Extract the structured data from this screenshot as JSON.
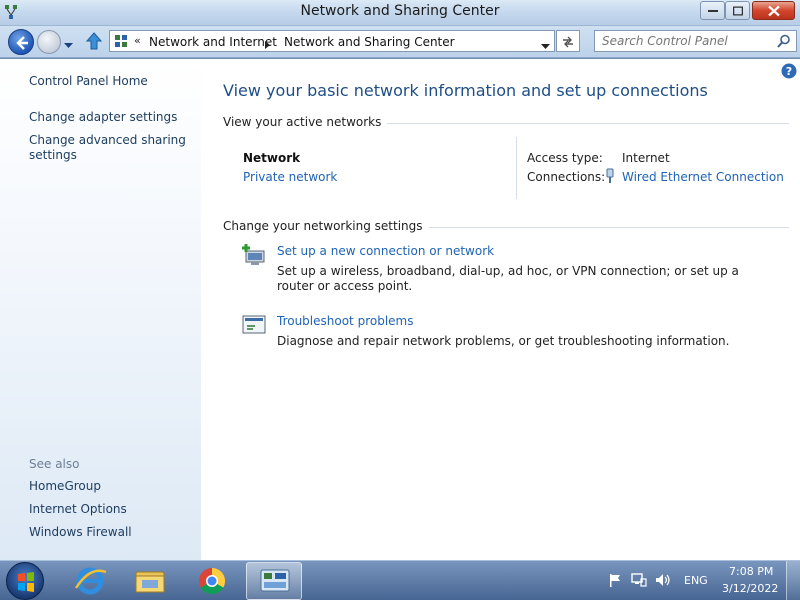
{
  "window": {
    "title": "Network and Sharing Center"
  },
  "navbar": {
    "breadcrumb": [
      "Network and Internet",
      "Network and Sharing Center"
    ],
    "overflow_chevron": "«",
    "search_placeholder": "Search Control Panel"
  },
  "left_pane": {
    "links": [
      "Control Panel Home",
      "Change adapter settings",
      "Change advanced sharing settings"
    ],
    "see_also_label": "See also",
    "see_also_links": [
      "HomeGroup",
      "Internet Options",
      "Windows Firewall"
    ]
  },
  "main": {
    "title": "View your basic network information and set up connections",
    "active_networks_heading": "View your active networks",
    "network": {
      "name": "Network",
      "type": "Private network",
      "access_type_label": "Access type:",
      "access_type_value": "Internet",
      "connections_label": "Connections:",
      "connection_name": "Wired Ethernet Connection"
    },
    "settings_heading": "Change your networking settings",
    "tasks": [
      {
        "link": "Set up a new connection or network",
        "description": "Set up a wireless, broadband, dial-up, ad hoc, or VPN connection; or set up a router or access point.",
        "icon": "new-connection-icon"
      },
      {
        "link": "Troubleshoot problems",
        "description": "Diagnose and repair network problems, or get troubleshooting information.",
        "icon": "troubleshoot-icon"
      }
    ]
  },
  "taskbar": {
    "pinned": [
      "internet-explorer-icon",
      "file-explorer-icon",
      "chrome-icon",
      "control-panel-icon"
    ],
    "language": "ENG",
    "time": "7:08 PM",
    "date": "3/12/2022"
  },
  "colors": {
    "link": "#1f63b5",
    "title": "#1e4e86",
    "left_link": "#1c3c5e"
  }
}
